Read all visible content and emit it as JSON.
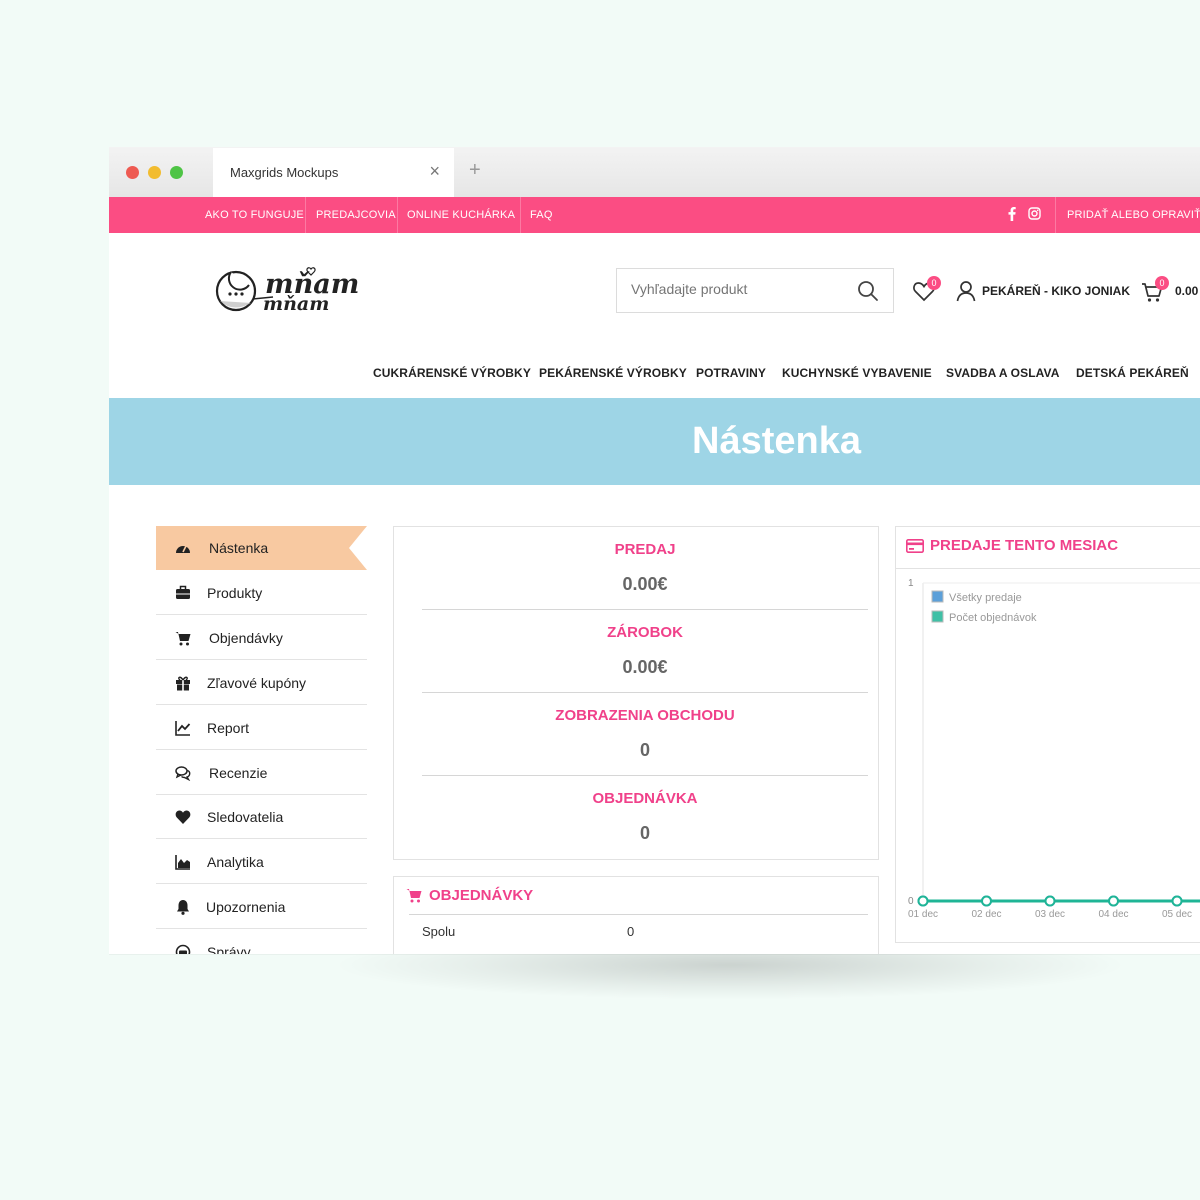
{
  "browser": {
    "tab_title": "Maxgrids Mockups",
    "close_glyph": "×",
    "new_tab_glyph": "+"
  },
  "topbar": {
    "links": [
      "AKO TO FUNGUJE",
      "PREDAJCOVIA",
      "ONLINE KUCHÁRKA",
      "FAQ"
    ],
    "right_link": "PRIDAŤ ALEBO OPRAVIŤ P",
    "social": [
      "facebook-icon",
      "instagram-icon"
    ]
  },
  "header": {
    "search_placeholder": "Vyhľadajte produkt",
    "wishlist_count": "0",
    "user_name": "PEKÁREŇ - KIKO JONIAK",
    "cart_count": "0",
    "cart_total": "0.00"
  },
  "nav": [
    "CUKRÁRENSKÉ VÝROBKY",
    "PEKÁRENSKÉ VÝROBKY",
    "POTRAVINY",
    "KUCHYNSKÉ VYBAVENIE",
    "SVADBA A OSLAVA",
    "DETSKÁ PEKÁREŇ"
  ],
  "hero": {
    "title": "Nástenka"
  },
  "sidebar": {
    "items": [
      {
        "label": "Nástenka",
        "icon": "dashboard-icon",
        "active": true
      },
      {
        "label": "Produkty",
        "icon": "briefcase-icon"
      },
      {
        "label": "Objendávky",
        "icon": "cart-icon"
      },
      {
        "label": "Zľavové kupóny",
        "icon": "gift-icon"
      },
      {
        "label": "Report",
        "icon": "line-chart-icon"
      },
      {
        "label": "Recenzie",
        "icon": "comments-icon"
      },
      {
        "label": "Sledovatelia",
        "icon": "heart-icon"
      },
      {
        "label": "Analytika",
        "icon": "area-chart-icon"
      },
      {
        "label": "Upozornenia",
        "icon": "bell-icon"
      },
      {
        "label": "Správy",
        "icon": "messages-icon"
      }
    ]
  },
  "stats": [
    {
      "title": "PREDAJ",
      "value": "0.00€"
    },
    {
      "title": "ZÁROBOK",
      "value": "0.00€"
    },
    {
      "title": "ZOBRAZENIA OBCHODU",
      "value": "0"
    },
    {
      "title": "OBJEDNÁVKA",
      "value": "0"
    }
  ],
  "orders": {
    "title": "OBJEDNÁVKY",
    "rows": [
      {
        "label": "Spolu",
        "value": "0"
      }
    ]
  },
  "chart_panel": {
    "title": "PREDAJE TENTO MESIAC"
  },
  "chart_data": {
    "type": "line",
    "title": "",
    "x": [
      "01 dec",
      "02 dec",
      "03 dec",
      "04 dec",
      "05 dec"
    ],
    "series": [
      {
        "name": "Všetky predaje",
        "color": "#3f8fd2",
        "values": [
          0,
          0,
          0,
          0,
          0
        ]
      },
      {
        "name": "Počet objednávok",
        "color": "#1fb596",
        "values": [
          0,
          0,
          0,
          0,
          0
        ]
      }
    ],
    "ylim": [
      0,
      1
    ],
    "yticks": [
      "0",
      "1"
    ],
    "legend_position": "top-left"
  }
}
